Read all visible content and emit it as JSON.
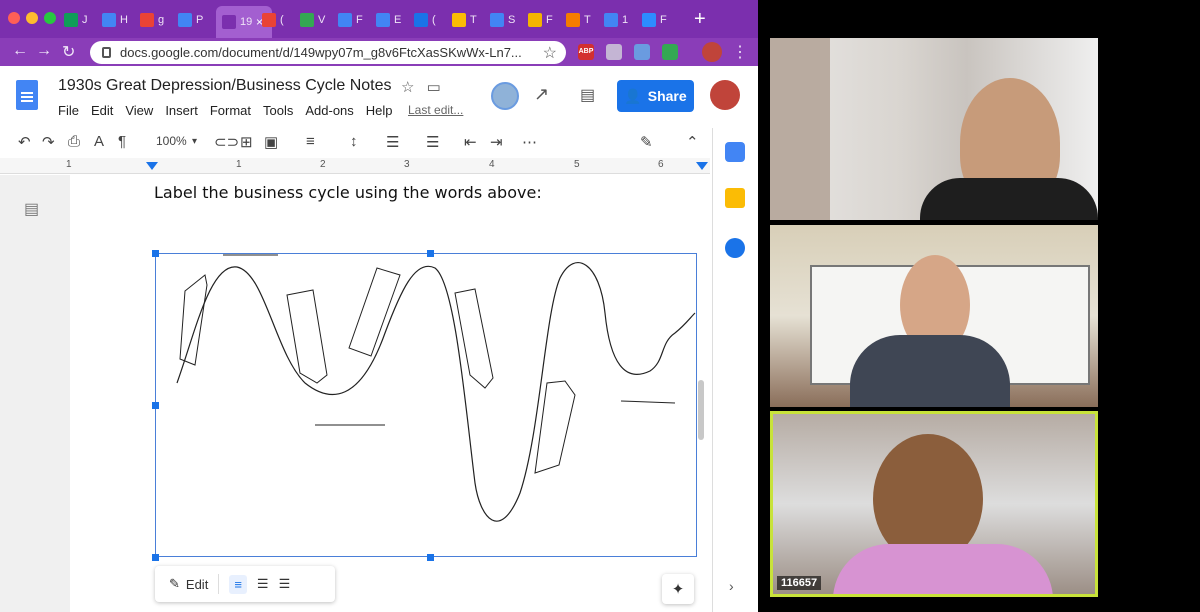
{
  "browser": {
    "tabs": [
      {
        "label": "J",
        "color": "#0f9d58"
      },
      {
        "label": "H",
        "color": "#4285f4"
      },
      {
        "label": "g",
        "color": "#ea4335"
      },
      {
        "label": "P",
        "color": "#4285f4"
      },
      {
        "label": "19",
        "color": "#7b2fae",
        "active": true
      },
      {
        "label": "(",
        "color": "#ea4335"
      },
      {
        "label": "V",
        "color": "#34a853"
      },
      {
        "label": "F",
        "color": "#4285f4"
      },
      {
        "label": "E",
        "color": "#4285f4"
      },
      {
        "label": "(",
        "color": "#1a73e8"
      },
      {
        "label": "T",
        "color": "#fbbc05"
      },
      {
        "label": "S",
        "color": "#4285f4"
      },
      {
        "label": "F",
        "color": "#f4b400"
      },
      {
        "label": "T",
        "color": "#f57c00"
      },
      {
        "label": "1",
        "color": "#4285f4"
      },
      {
        "label": "F",
        "color": "#2d8cff"
      }
    ],
    "new_tab": "+",
    "url": "docs.google.com/document/d/149wpy07m_g8v6FtcXasSKwWx-Ln7...",
    "extensions": [
      {
        "label": "ABP",
        "color": "#d32f2f"
      }
    ]
  },
  "doc": {
    "title": "1930s Great Depression/Business Cycle Notes",
    "menus": [
      "File",
      "Edit",
      "View",
      "Insert",
      "Format",
      "Tools",
      "Add-ons",
      "Help"
    ],
    "last_edit": "Last edit...",
    "share_label": "Share",
    "zoom": "100%",
    "ruler_numbers": [
      "1",
      "1",
      "2",
      "3",
      "4",
      "5",
      "6"
    ],
    "body_text": "Label the business cycle using the words above:",
    "edit_label": "Edit"
  },
  "zoom_call": {
    "participants": [
      {
        "name": "",
        "speaking": false
      },
      {
        "name": "",
        "speaking": false
      },
      {
        "name": "116657",
        "speaking": true
      }
    ]
  },
  "colors": {
    "tab_bar": "#7b2fae",
    "address_bar": "#8a3db8",
    "share_button": "#1a73e8",
    "active_speaker_border": "#c8e33a"
  }
}
